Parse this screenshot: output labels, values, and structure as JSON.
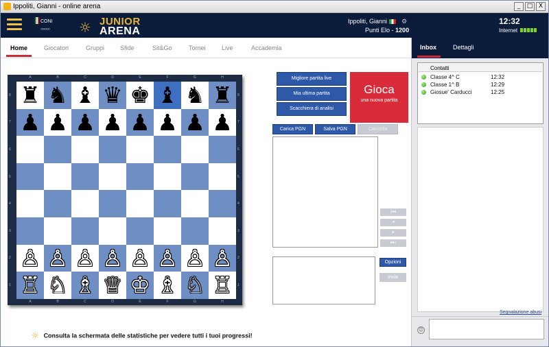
{
  "window": {
    "title": "Ippoliti, Gianni - online arena",
    "buttons": [
      "_",
      "□",
      "X"
    ]
  },
  "header": {
    "coni_label": "CONI",
    "coni_rings": "○○○○○",
    "logo_top": "JUNIOR",
    "logo_bottom": "ARENA",
    "user_name": "Ippoliti, Gianni",
    "punti_label": "Punti Elo -",
    "punti_value": "1200",
    "time": "12:32",
    "internet_label": "Internet"
  },
  "nav": {
    "tabs": [
      "Home",
      "Giocatori",
      "Gruppi",
      "Sfide",
      "Sit&Go",
      "Tornei",
      "Live",
      "Accademia"
    ],
    "active": "Home"
  },
  "right_panel": {
    "tabs": [
      "Inbox",
      "Dettagli"
    ],
    "active": "Inbox",
    "contacts_header": {
      "name": "Contatti",
      "time": ""
    },
    "contacts": [
      {
        "name": "Classe 4^ C",
        "time": "12:32"
      },
      {
        "name": "Classe 1^ B",
        "time": "12:29"
      },
      {
        "name": "Giosue' Carducci",
        "time": "12:25"
      }
    ],
    "report_link": "Segnalazione abusi"
  },
  "board": {
    "files": [
      "A",
      "B",
      "C",
      "D",
      "E",
      "F",
      "G",
      "H"
    ],
    "ranks": [
      "8",
      "7",
      "6",
      "5",
      "4",
      "3",
      "2",
      "1"
    ],
    "highlighted": [
      "F8"
    ],
    "rows": [
      [
        "♜",
        "♞",
        "♝",
        "♛",
        "♚",
        "♝",
        "♞",
        "♜"
      ],
      [
        "♟",
        "♟",
        "♟",
        "♟",
        "♟",
        "♟",
        "♟",
        "♟"
      ],
      [
        "",
        "",
        "",
        "",
        "",
        "",
        "",
        ""
      ],
      [
        "",
        "",
        "",
        "",
        "",
        "",
        "",
        ""
      ],
      [
        "",
        "",
        "",
        "",
        "",
        "",
        "",
        ""
      ],
      [
        "",
        "",
        "",
        "",
        "",
        "",
        "",
        ""
      ],
      [
        "♙",
        "♙",
        "♙",
        "♙",
        "♙",
        "♙",
        "♙",
        "♙"
      ],
      [
        "♖",
        "♘",
        "♗",
        "♕",
        "♔",
        "♗",
        "♘",
        "♖"
      ]
    ],
    "colors": {
      "light": "#ffffff",
      "dark": "#6f8fc4",
      "highlight": "#3e6fc0"
    }
  },
  "actions": {
    "best_live": "Migliore partita live",
    "last_game": "Mia ultima partita",
    "analysis_board": "Scacchiera di analisi",
    "play_title": "Gioca",
    "play_subtitle": "una nuova partita",
    "load_pgn": "Carica PGN",
    "save_pgn": "Salva PGN",
    "delete": "Cancella",
    "nav_first": "|◂◂",
    "nav_prev": "◂",
    "nav_next": "▸",
    "nav_last": "▸▸|",
    "options": "Opzioni",
    "send": "Invia"
  },
  "footer": {
    "message": "Consulta la schermata delle statistiche per vedere tutti i tuoi progressi!"
  }
}
